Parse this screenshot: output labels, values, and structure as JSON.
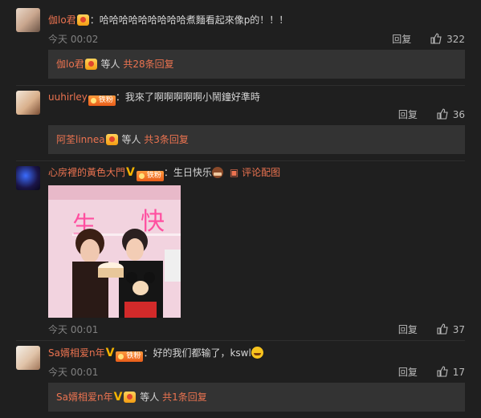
{
  "comments": [
    {
      "username": "伽lo君",
      "text": "：哈哈哈哈哈哈哈哈哈煮麵看起來像p的！！！",
      "time": "今天 00:02",
      "reply_label": "回复",
      "likes": "322",
      "replies": {
        "user": "伽lo君",
        "mid": "等人",
        "count": "共28条回复"
      }
    },
    {
      "username": "uuhirley",
      "fan_badge": "铁粉",
      "text": "：我來了啊啊啊啊啊小鬧鐘好準時",
      "reply_label": "回复",
      "likes": "36",
      "replies": {
        "user": "阿荃linnea",
        "mid": "等人",
        "count": "共3条回复"
      }
    },
    {
      "username": "心房裡的黃色大門",
      "fan_badge": "铁粉",
      "text": "：生日快乐",
      "picture_link": "评论配图",
      "time": "今天 00:01",
      "reply_label": "回复",
      "likes": "37",
      "photo_text": {
        "p1": "生",
        "p2": "快"
      }
    },
    {
      "username": "Sa婿相爱n年",
      "fan_badge": "铁粉",
      "text": "：好的我们都输了，kswl",
      "time": "今天 00:01",
      "reply_label": "回复",
      "likes": "17",
      "replies": {
        "user": "Sa婿相爱n年",
        "mid": "等人",
        "count": "共1条回复"
      }
    }
  ],
  "icons": [
    "avatar",
    "crown-badge-icon",
    "fan-badge-icon",
    "verified-v-icon",
    "cake-icon",
    "picture-icon",
    "smile-emoji-icon",
    "thumbs-up-icon"
  ],
  "colors": {
    "background": "#1f1f1f",
    "username": "#eb7350",
    "reply_box": "#333333",
    "meta": "#808080"
  }
}
